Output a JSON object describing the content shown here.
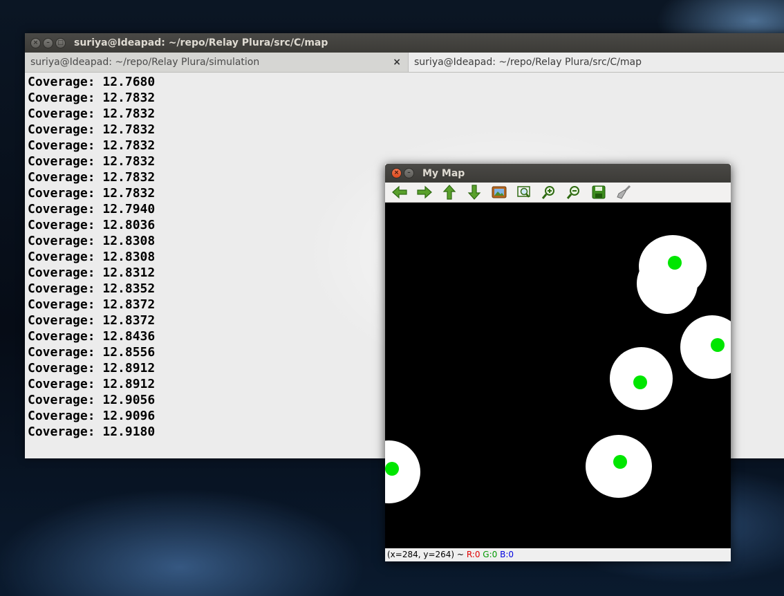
{
  "terminal": {
    "title": "suriya@Ideapad: ~/repo/Relay Plura/src/C/map",
    "tabs": [
      {
        "label": "suriya@Ideapad: ~/repo/Relay Plura/simulation",
        "close": "×"
      },
      {
        "label": "suriya@Ideapad: ~/repo/Relay Plura/src/C/map"
      }
    ],
    "lines": [
      "Coverage: 12.7680",
      "Coverage: 12.7832",
      "Coverage: 12.7832",
      "Coverage: 12.7832",
      "Coverage: 12.7832",
      "Coverage: 12.7832",
      "Coverage: 12.7832",
      "Coverage: 12.7832",
      "Coverage: 12.7940",
      "Coverage: 12.8036",
      "Coverage: 12.8308",
      "Coverage: 12.8308",
      "Coverage: 12.8312",
      "Coverage: 12.8352",
      "Coverage: 12.8372",
      "Coverage: 12.8372",
      "Coverage: 12.8436",
      "Coverage: 12.8556",
      "Coverage: 12.8912",
      "Coverage: 12.8912",
      "Coverage: 12.9056",
      "Coverage: 12.9096",
      "Coverage: 12.9180"
    ]
  },
  "map_window": {
    "title": "My Map",
    "toolbar": [
      "arrow-left-icon",
      "arrow-right-icon",
      "arrow-up-icon",
      "arrow-down-icon",
      "image-icon",
      "zoom-fit-icon",
      "zoom-in-icon",
      "zoom-out-icon",
      "save-icon",
      "brush-icon"
    ],
    "status": {
      "coords": "(x=284, y=264) ~",
      "r": "R:0",
      "g": "G:0",
      "b": "B:0"
    },
    "colors": {
      "covered": "#ffffff",
      "node": "#00e600",
      "background": "#000000"
    }
  }
}
